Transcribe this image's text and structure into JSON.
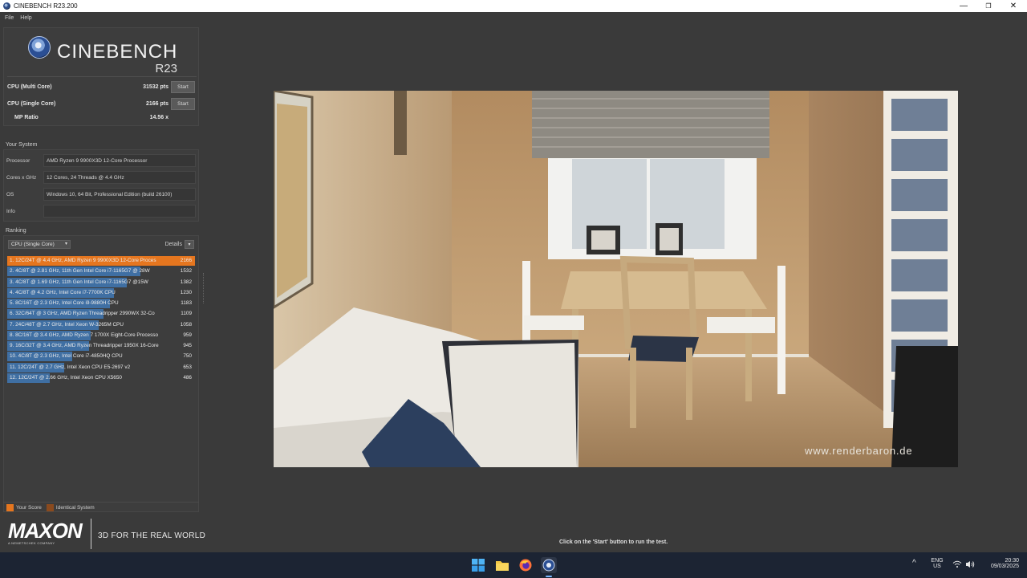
{
  "window": {
    "title": "CINEBENCH R23.200",
    "controls": {
      "minimize": "—",
      "maximize": "❐",
      "close": "✕"
    }
  },
  "menu": {
    "items": [
      "File",
      "Help"
    ]
  },
  "logo": {
    "word": "CINEBENCH",
    "version": "R23"
  },
  "scores": {
    "multi": {
      "label": "CPU (Multi Core)",
      "value": "31532 pts",
      "button": "Start"
    },
    "single": {
      "label": "CPU (Single Core)",
      "value": "2166 pts",
      "button": "Start"
    },
    "ratio": {
      "label": "MP Ratio",
      "value": "14.56 x"
    }
  },
  "system": {
    "title": "Your System",
    "rows": [
      {
        "key": "Processor",
        "value": "AMD Ryzen 9 9900X3D 12-Core Processor"
      },
      {
        "key": "Cores x GHz",
        "value": "12 Cores, 24 Threads @ 4.4 GHz"
      },
      {
        "key": "OS",
        "value": "Windows 10, 64 Bit, Professional Edition (build 26100)"
      },
      {
        "key": "Info",
        "value": ""
      }
    ]
  },
  "ranking": {
    "title": "Ranking",
    "mode": "CPU (Single Core)",
    "details_label": "Details",
    "max_score": 2166,
    "items": [
      {
        "name": "1. 12C/24T @ 4.4 GHz, AMD Ryzen 9 9900X3D 12-Core Proces",
        "score": 2166,
        "me": true
      },
      {
        "name": "2. 4C/8T @ 2.81 GHz, 11th Gen Intel Core i7-1165G7 @ 28W",
        "score": 1532,
        "me": false
      },
      {
        "name": "3. 4C/8T @ 1.69 GHz, 11th Gen Intel Core i7-1165G7 @15W",
        "score": 1382,
        "me": false
      },
      {
        "name": "4. 4C/8T @ 4.2 GHz, Intel Core i7-7700K CPU",
        "score": 1230,
        "me": false
      },
      {
        "name": "5. 8C/16T @ 2.3 GHz, Intel Core i9-9880H CPU",
        "score": 1183,
        "me": false
      },
      {
        "name": "6. 32C/64T @ 3 GHz, AMD Ryzen Threadripper 2990WX 32-Co",
        "score": 1109,
        "me": false
      },
      {
        "name": "7. 24C/48T @ 2.7 GHz, Intel Xeon W-3265M CPU",
        "score": 1058,
        "me": false
      },
      {
        "name": "8. 8C/16T @ 3.4 GHz, AMD Ryzen 7 1700X Eight-Core Processo",
        "score": 959,
        "me": false
      },
      {
        "name": "9. 16C/32T @ 3.4 GHz, AMD Ryzen Threadripper 1950X 16-Core",
        "score": 945,
        "me": false
      },
      {
        "name": "10. 4C/8T @ 2.3 GHz, Intel Core i7-4850HQ CPU",
        "score": 750,
        "me": false
      },
      {
        "name": "11. 12C/24T @ 2.7 GHz, Intel Xeon CPU E5-2697 v2",
        "score": 653,
        "me": false
      },
      {
        "name": "12. 12C/24T @ 2.66 GHz, Intel Xeon CPU X5650",
        "score": 486,
        "me": false
      }
    ]
  },
  "legend": {
    "items": [
      {
        "label": "Your Score",
        "color": "#e5761f"
      },
      {
        "label": "Identical System",
        "color": "#8a4a1e"
      }
    ]
  },
  "brand": {
    "maxon": "MAXON",
    "maxon_sub": "A NEMETSCHEK COMPANY",
    "tagline": "3D FOR THE REAL WORLD"
  },
  "render": {
    "watermark": "www.renderbaron.de"
  },
  "status": {
    "text": "Click on the 'Start' button to run the test."
  },
  "taskbar": {
    "apps": [
      "windows-start-icon",
      "file-explorer-icon",
      "firefox-icon",
      "cinebench-icon"
    ],
    "lang_top": "ENG",
    "lang_bottom": "US",
    "time": "20:30",
    "date": "09/03/2025"
  },
  "colors": {
    "accent_orange": "#e5761f",
    "bar_blue": "#3f6fa3",
    "background": "#3a3a3a"
  }
}
